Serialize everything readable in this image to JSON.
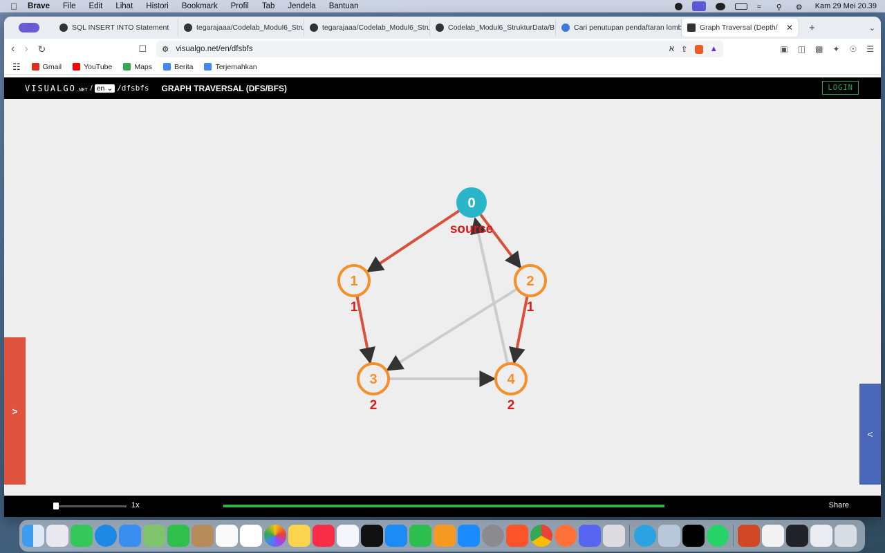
{
  "menubar": {
    "app": "Brave",
    "items": [
      "File",
      "Edit",
      "Lihat",
      "Histori",
      "Bookmark",
      "Profil",
      "Tab",
      "Jendela",
      "Bantuan"
    ],
    "clock": "Kam 29 Mei  20.39"
  },
  "tabs": [
    {
      "label": "SQL INSERT INTO Statement",
      "color": "#2e7d32"
    },
    {
      "label": "tegarajaaa/Codelab_Modul6_Stru",
      "color": "#222222"
    },
    {
      "label": "tegarajaaa/Codelab_Modul6_Stru",
      "color": "#222222"
    },
    {
      "label": "Codelab_Modul6_StrukturData/B",
      "color": "#222222"
    },
    {
      "label": "Cari penutupan pendaftaran lomb",
      "color": "#3b7bd8"
    },
    {
      "label": "Graph Traversal (Depth/Bread",
      "color": "#000000"
    }
  ],
  "address": {
    "url": "visualgo.net/en/dfsbfs"
  },
  "bookmarks": [
    {
      "label": "Gmail",
      "color": "#d93025"
    },
    {
      "label": "YouTube",
      "color": "#ff0000"
    },
    {
      "label": "Maps",
      "color": "#34a853"
    },
    {
      "label": "Berita",
      "color": "#4285f4"
    },
    {
      "label": "Terjemahkan",
      "color": "#4285f4"
    }
  ],
  "visualgo": {
    "logo": "VISUALGO",
    "logo_suffix": ".NET",
    "lang": "en",
    "path": "/dfsbfs",
    "title": "GRAPH TRAVERSAL (DFS/BFS)",
    "login": "LOGIN",
    "left_toggle": ">",
    "right_toggle": "<",
    "speed": "1x",
    "progress": 1.0,
    "share": "Share"
  },
  "graph": {
    "nodes": [
      {
        "id": "0",
        "label": "0",
        "sublabel": "source",
        "state": "source"
      },
      {
        "id": "1",
        "label": "1",
        "sublabel": "1",
        "state": "visited"
      },
      {
        "id": "2",
        "label": "2",
        "sublabel": "1",
        "state": "visited"
      },
      {
        "id": "3",
        "label": "3",
        "sublabel": "2",
        "state": "visited"
      },
      {
        "id": "4",
        "label": "4",
        "sublabel": "2",
        "state": "visited"
      }
    ],
    "edges": [
      {
        "from": "0",
        "to": "1",
        "state": "tree"
      },
      {
        "from": "0",
        "to": "2",
        "state": "tree"
      },
      {
        "from": "1",
        "to": "3",
        "state": "tree"
      },
      {
        "from": "2",
        "to": "4",
        "state": "tree"
      },
      {
        "from": "2",
        "to": "3",
        "state": "normal"
      },
      {
        "from": "3",
        "to": "4",
        "state": "normal"
      },
      {
        "from": "4",
        "to": "0",
        "state": "normal"
      }
    ],
    "colors": {
      "source": "#29b6c8",
      "visited": "#f4902a",
      "tree": "#d9503c",
      "normal": "#cccccc",
      "sublabel": "#d71a1a"
    }
  }
}
